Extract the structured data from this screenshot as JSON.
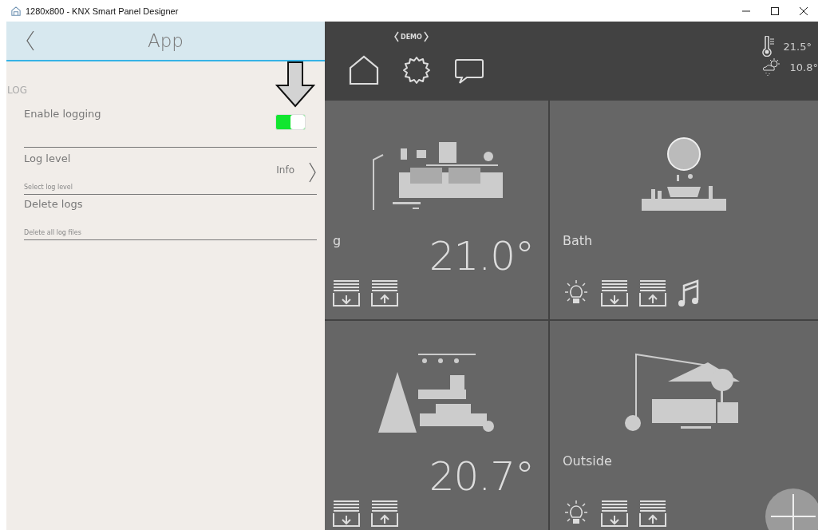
{
  "window": {
    "title": "1280x800 - KNX Smart Panel Designer"
  },
  "settings": {
    "title": "App",
    "section": "LOG",
    "items": [
      {
        "kind": "toggle",
        "label": "Enable logging",
        "on": true
      },
      {
        "kind": "choice",
        "label": "Log level",
        "sublabel": "Select log level",
        "value": "Info"
      },
      {
        "kind": "action",
        "label": "Delete logs",
        "sublabel": "Delete all log files"
      }
    ]
  },
  "header": {
    "badge": "DEMO",
    "weather": [
      {
        "kind": "indoor",
        "value": "21.5°"
      },
      {
        "kind": "outdoor",
        "value": "10.8°"
      }
    ]
  },
  "tiles": [
    {
      "kind": "living",
      "name": "g",
      "temperature": "21.0°",
      "controls": [
        {
          "kind": "blind_down"
        },
        {
          "kind": "blind_up"
        }
      ]
    },
    {
      "kind": "bath",
      "name": "Bath",
      "controls": [
        {
          "kind": "light"
        },
        {
          "kind": "blind_down"
        },
        {
          "kind": "blind_up"
        },
        {
          "kind": "music"
        }
      ]
    },
    {
      "kind": "kids",
      "temperature": "20.7°",
      "controls": [
        {
          "kind": "blind_down"
        },
        {
          "kind": "blind_up"
        }
      ]
    },
    {
      "kind": "outside",
      "name": "Outside",
      "controls": [
        {
          "kind": "light"
        },
        {
          "kind": "blind_down"
        },
        {
          "kind": "blind_up"
        }
      ]
    }
  ]
}
